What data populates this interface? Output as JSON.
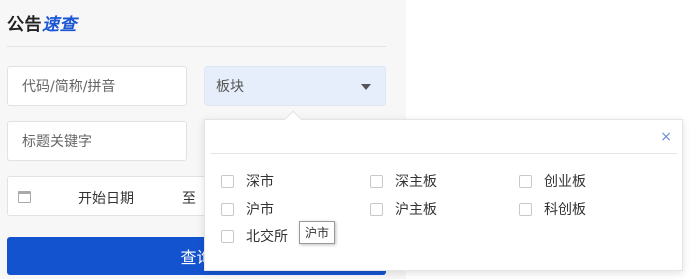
{
  "header": {
    "title_part1": "公告",
    "title_part2": "速查"
  },
  "search": {
    "code_placeholder": "代码/简称/拼音",
    "board_label": "板块",
    "keyword_placeholder": "标题关键字",
    "date_start_placeholder": "开始日期",
    "date_separator": "至",
    "query_label": "查询"
  },
  "board_dropdown": {
    "close_symbol": "×",
    "options": [
      {
        "label": "深市",
        "checked": false
      },
      {
        "label": "深主板",
        "checked": false
      },
      {
        "label": "创业板",
        "checked": false
      },
      {
        "label": "沪市",
        "checked": false
      },
      {
        "label": "沪主板",
        "checked": false
      },
      {
        "label": "科创板",
        "checked": false
      },
      {
        "label": "北交所",
        "checked": false
      }
    ]
  },
  "tooltip": {
    "text": "沪市"
  },
  "colors": {
    "accent": "#1453d0",
    "title_accent": "#1a56d6",
    "select_bg": "#e7eefb"
  }
}
